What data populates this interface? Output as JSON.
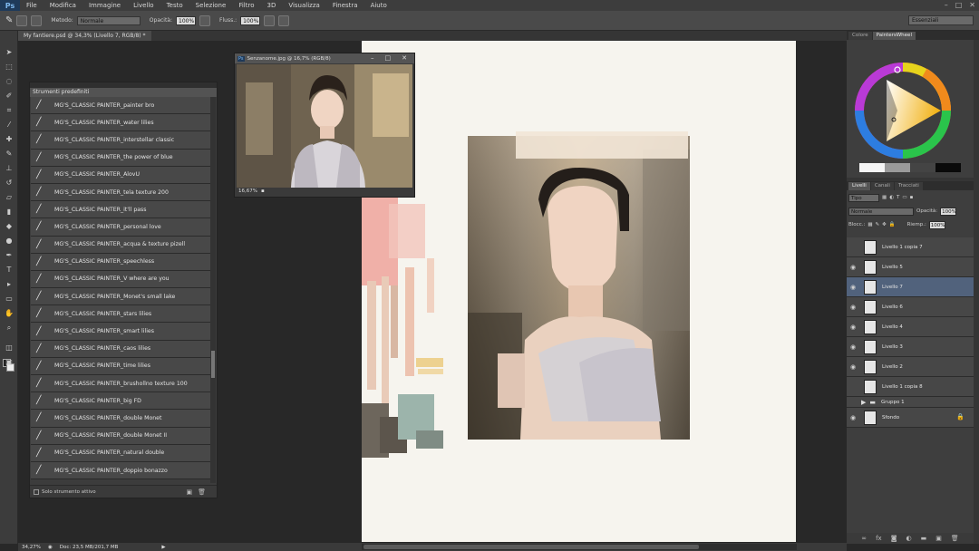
{
  "app": {
    "logo": "Ps"
  },
  "menu": [
    "File",
    "Modifica",
    "Immagine",
    "Livello",
    "Testo",
    "Selezione",
    "Filtro",
    "3D",
    "Visualizza",
    "Finestra",
    "Aiuto"
  ],
  "window_buttons": [
    "–",
    "□",
    "✕"
  ],
  "options": {
    "mode_label": "Metodo:",
    "mode_value": "Normale",
    "opacity_label": "Opacità:",
    "opacity_value": "100%",
    "flow_label": "Fluss.:",
    "flow_value": "100%",
    "workspace": "Essenziali"
  },
  "document_tab": "My fantiere.psd @ 34,3% (Livello 7, RGB/8) *",
  "presets": {
    "title": "Strumenti predefiniti",
    "items": [
      "MG'S_CLASSIC PAINTER_painter bro",
      "MG'S_CLASSIC PAINTER_water lilies",
      "MG'S_CLASSIC PAINTER_interstellar classic",
      "MG'S_CLASSIC PAINTER_the power of blue",
      "MG'S_CLASSIC PAINTER_AlovU",
      "MG'S_CLASSIC PAINTER_tela texture 200",
      "MG'S_CLASSIC PAINTER_it'll pass",
      "MG'S_CLASSIC PAINTER_personal love",
      "MG'S_CLASSIC PAINTER_acqua & texture pizell",
      "MG'S_CLASSIC PAINTER_speechless",
      "MG'S_CLASSIC PAINTER_V where are you",
      "MG'S_CLASSIC PAINTER_Monet's small lake",
      "MG'S_CLASSIC PAINTER_stars lilies",
      "MG'S_CLASSIC PAINTER_smart lilies",
      "MG'S_CLASSIC PAINTER_caos lilies",
      "MG'S_CLASSIC PAINTER_time lilies",
      "MG'S_CLASSIC PAINTER_brushollno texture 100",
      "MG'S_CLASSIC PAINTER_big FD",
      "MG'S_CLASSIC PAINTER_double Monet",
      "MG'S_CLASSIC PAINTER_double Monet II",
      "MG'S_CLASSIC PAINTER_natural double",
      "MG'S_CLASSIC PAINTER_doppio bonazzo"
    ],
    "footer": "Solo strumento attivo"
  },
  "reference_window": {
    "title": "Senzanome.jpg @ 16,7% (RGB/8)",
    "zoom": "16,67%"
  },
  "color_panel": {
    "tabs": [
      "Colore",
      "PaintersWheel"
    ]
  },
  "layers_panel": {
    "tabs": [
      "Livelli",
      "Canali",
      "Tracciati"
    ],
    "filter": "Tipo",
    "blend": "Normale",
    "opacity_label": "Opacità:",
    "opacity_value": "100%",
    "lock_label": "Blocc.:",
    "fill_label": "Riemp.:",
    "fill_value": "100%",
    "layers": [
      {
        "name": "Livello 1 copia 7",
        "selected": false,
        "visible": false
      },
      {
        "name": "Livello 5",
        "selected": false,
        "visible": true
      },
      {
        "name": "Livello 7",
        "selected": true,
        "visible": true
      },
      {
        "name": "Livello 6",
        "selected": false,
        "visible": true
      },
      {
        "name": "Livello 4",
        "selected": false,
        "visible": true
      },
      {
        "name": "Livello 3",
        "selected": false,
        "visible": true
      },
      {
        "name": "Livello 2",
        "selected": false,
        "visible": true
      },
      {
        "name": "Livello 1 copia 8",
        "selected": false,
        "visible": false
      },
      {
        "name": "Gruppo 1",
        "selected": false,
        "visible": false
      },
      {
        "name": "Sfondo",
        "selected": false,
        "visible": true
      }
    ]
  },
  "status": {
    "zoom": "34,27%",
    "doc": "Doc: 23,5 MB/201,7 MB"
  },
  "colors": {
    "accent": "#51627c",
    "bg": "#282828",
    "panel": "#3e3e3e"
  }
}
